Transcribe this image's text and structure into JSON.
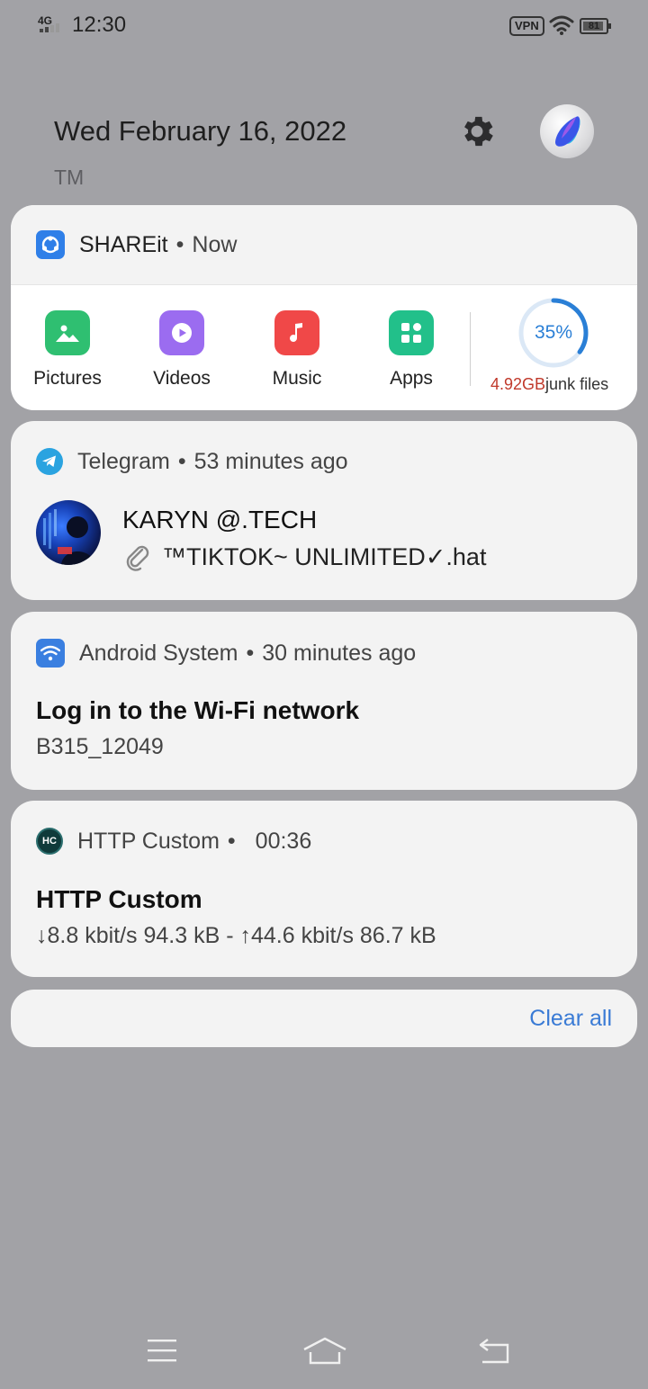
{
  "status_bar": {
    "network": "4G",
    "time": "12:30",
    "vpn": "VPN",
    "battery": "81"
  },
  "header": {
    "date": "Wed February 16, 2022",
    "carrier": "TM"
  },
  "notifications": {
    "shareit": {
      "app": "SHAREit",
      "time": "Now",
      "tools": [
        {
          "label": "Pictures",
          "color": "#2fbf71",
          "icon": "image-icon"
        },
        {
          "label": "Videos",
          "color": "#9b6cf0",
          "icon": "play-icon"
        },
        {
          "label": "Music",
          "color": "#f04848",
          "icon": "music-note-icon"
        },
        {
          "label": "Apps",
          "color": "#22c08a",
          "icon": "grid-icon"
        }
      ],
      "junk_percent": "35%",
      "junk_percent_value": 0.35,
      "junk_size": "4.92GB",
      "junk_text": "junk files"
    },
    "telegram": {
      "app": "Telegram",
      "time": "53 minutes ago",
      "sender": "KARYN @.TECH",
      "message": "™TIKTOK~ UNLIMITED✓.hat"
    },
    "android_system": {
      "app": "Android System",
      "time": "30 minutes ago",
      "title": "Log in to the Wi-Fi network",
      "subtitle": "B315_12049"
    },
    "http_custom": {
      "app": "HTTP Custom",
      "time": "00:36",
      "title": "HTTP Custom",
      "stats": "↓8.8 kbit/s 94.3 kB - ↑44.6 kbit/s 86.7 kB",
      "icon_text": "HC"
    }
  },
  "clear_all_label": "Clear all",
  "colors": {
    "background": "#a2a2a6",
    "card": "#f3f3f3",
    "accent": "#3a7bd5",
    "junk_red": "#c0392b"
  }
}
